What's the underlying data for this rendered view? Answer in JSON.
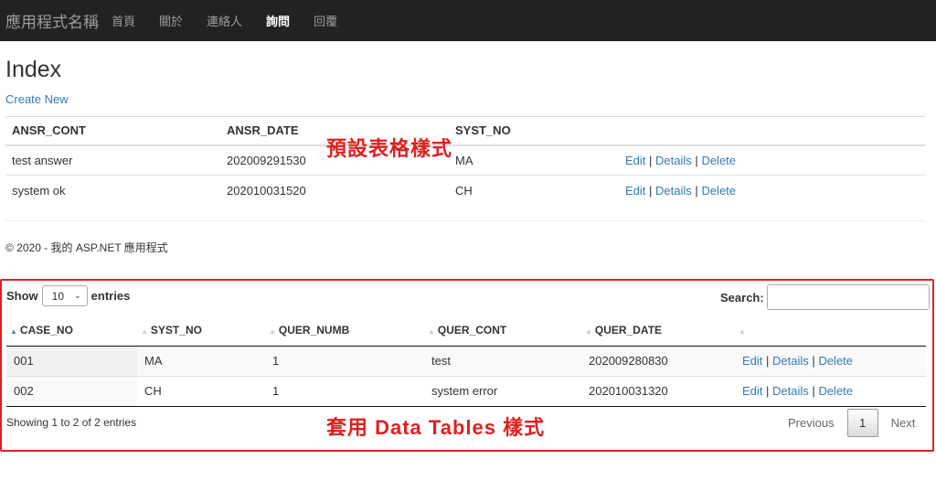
{
  "navbar": {
    "brand": "應用程式名稱",
    "items": [
      {
        "label": "首頁"
      },
      {
        "label": "關於"
      },
      {
        "label": "連絡人"
      },
      {
        "label": "詢問"
      },
      {
        "label": "回覆"
      }
    ]
  },
  "page": {
    "title": "Index",
    "create_new": "Create New",
    "footer": "© 2020 - 我的 ASP.NET 應用程式"
  },
  "default_table": {
    "headers": [
      "ANSR_CONT",
      "ANSR_DATE",
      "SYST_NO"
    ],
    "rows": [
      {
        "cont": "test answer",
        "date": "202009291530",
        "syst": "MA"
      },
      {
        "cont": "system ok",
        "date": "202010031520",
        "syst": "CH"
      }
    ],
    "actions": {
      "edit": "Edit",
      "details": "Details",
      "delete": "Delete",
      "sep": "|"
    }
  },
  "annotations": {
    "default_style": "預設表格樣式",
    "datatables_style": "套用 Data Tables 樣式"
  },
  "datatable": {
    "show_label": "Show",
    "entries_label": "entries",
    "page_length": "10",
    "search_label": "Search:",
    "search_value": "",
    "headers": [
      "CASE_NO",
      "SYST_NO",
      "QUER_NUMB",
      "QUER_CONT",
      "QUER_DATE"
    ],
    "rows": [
      {
        "case": "001",
        "syst": "MA",
        "numb": "1",
        "cont": "test",
        "date": "202009280830"
      },
      {
        "case": "002",
        "syst": "CH",
        "numb": "1",
        "cont": "system error",
        "date": "202010031320"
      }
    ],
    "info": "Showing 1 to 2 of 2 entries",
    "pagination": {
      "previous": "Previous",
      "current": "1",
      "next": "Next"
    }
  },
  "colors": {
    "link": "#337ab7",
    "annotation": "#e02020",
    "navbar": "#222222"
  }
}
